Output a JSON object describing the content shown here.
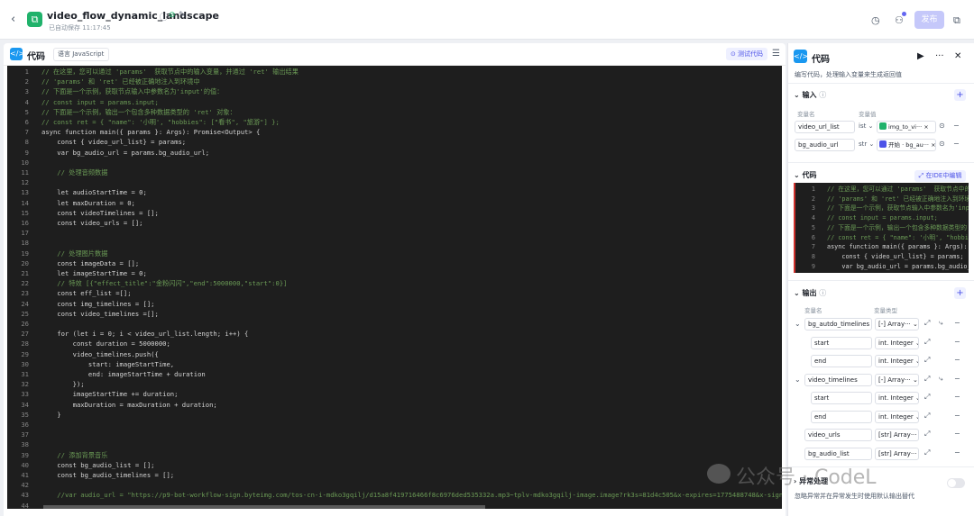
{
  "header": {
    "title": "video_flow_dynamic_landscape",
    "autosave": "已自动保存 11:17:45",
    "publish_label": "发布"
  },
  "code_panel": {
    "title": "代码",
    "language": "语言 JavaScript",
    "test_label": "测试代码",
    "lines": [
      {
        "n": "1",
        "t": "// 在这里，您可以通过 'params'  获取节点中的输入变量，并通过 'ret' 输出结果",
        "k": "comment"
      },
      {
        "n": "2",
        "t": "// 'params' 和 'ret' 已经被正确地注入到环境中",
        "k": "comment"
      },
      {
        "n": "3",
        "t": "// 下面是一个示例，获取节点输入中参数名为'input'的值：",
        "k": "comment"
      },
      {
        "n": "4",
        "t": "// const input = params.input;",
        "k": "comment"
      },
      {
        "n": "5",
        "t": "// 下面是一个示例，输出一个包含多种数据类型的 'ret' 对象：",
        "k": "comment"
      },
      {
        "n": "6",
        "t": "// const ret = { \"name\": '小明', \"hobbies\": [\"看书\", \"旅游\"] };",
        "k": "comment"
      },
      {
        "n": "7",
        "t": "async function main({ params }: Args): Promise<Output> {",
        "k": "kw"
      },
      {
        "n": "8",
        "t": "    const { video_url_list} = params;",
        "k": "kw"
      },
      {
        "n": "9",
        "t": "    var bg_audio_url = params.bg_audio_url;",
        "k": "kw"
      },
      {
        "n": "10",
        "t": "",
        "k": "kw"
      },
      {
        "n": "11",
        "t": "    // 处理音频数据",
        "k": "comment"
      },
      {
        "n": "12",
        "t": "",
        "k": "kw"
      },
      {
        "n": "13",
        "t": "    let audioStartTime = 0;",
        "k": "kw"
      },
      {
        "n": "14",
        "t": "    let maxDuration = 0;",
        "k": "kw"
      },
      {
        "n": "15",
        "t": "    const videoTimelines = [];",
        "k": "kw"
      },
      {
        "n": "16",
        "t": "    const video_urls = [];",
        "k": "kw"
      },
      {
        "n": "17",
        "t": "",
        "k": "kw"
      },
      {
        "n": "18",
        "t": "",
        "k": "kw"
      },
      {
        "n": "19",
        "t": "    // 处理图片数据",
        "k": "comment"
      },
      {
        "n": "20",
        "t": "    const imageData = [];",
        "k": "kw"
      },
      {
        "n": "21",
        "t": "    let imageStartTime = 0;",
        "k": "kw"
      },
      {
        "n": "22",
        "t": "    // 特效 [{\"effect_title\":\"金粉闪闪\",\"end\":5000000,\"start\":0}]",
        "k": "comment"
      },
      {
        "n": "23",
        "t": "    const eff_list =[];",
        "k": "kw"
      },
      {
        "n": "24",
        "t": "    const img_timelines = [];",
        "k": "kw"
      },
      {
        "n": "25",
        "t": "    const video_timelines =[];",
        "k": "kw"
      },
      {
        "n": "26",
        "t": "",
        "k": "kw"
      },
      {
        "n": "27",
        "t": "    for (let i = 0; i < video_url_list.length; i++) {",
        "k": "kw"
      },
      {
        "n": "28",
        "t": "        const duration = 5000000;",
        "k": "kw"
      },
      {
        "n": "29",
        "t": "        video_timelines.push({",
        "k": "kw"
      },
      {
        "n": "30",
        "t": "            start: imageStartTime,",
        "k": "squiggle"
      },
      {
        "n": "31",
        "t": "            end: imageStartTime + duration",
        "k": "squiggle"
      },
      {
        "n": "32",
        "t": "        });",
        "k": "kw"
      },
      {
        "n": "33",
        "t": "        imageStartTime += duration;",
        "k": "kw"
      },
      {
        "n": "34",
        "t": "        maxDuration = maxDuration + duration;",
        "k": "kw"
      },
      {
        "n": "35",
        "t": "    }",
        "k": "kw"
      },
      {
        "n": "36",
        "t": "",
        "k": "kw"
      },
      {
        "n": "37",
        "t": "",
        "k": "kw"
      },
      {
        "n": "38",
        "t": "",
        "k": "kw"
      },
      {
        "n": "39",
        "t": "    // 添加背景音乐",
        "k": "comment"
      },
      {
        "n": "40",
        "t": "    const bg_audio_list = [];",
        "k": "kw"
      },
      {
        "n": "41",
        "t": "    const bg_audio_timelines = [];",
        "k": "kw"
      },
      {
        "n": "42",
        "t": "",
        "k": "kw"
      },
      {
        "n": "43",
        "t": "    //var audio_url = \"https://p9-bot-workflow-sign.byteimg.com/tos-cn-i-mdko3gqilj/d15a8f419716466f8c6976ded535332a.mp3~tplv-mdko3gqilj-image.image?rk3s=81d4c505&x-expires=1775488748&x-signat",
        "k": "comment"
      },
      {
        "n": "44",
        "t": "",
        "k": "kw"
      }
    ]
  },
  "right_panel": {
    "title": "代码",
    "description": "编写代码，处理输入变量来生成返回值",
    "input_section": "输入",
    "col_var_name": "变量名",
    "col_var_value": "变量值",
    "inputs": [
      {
        "name": "video_url_list",
        "type": "ist",
        "ref": "img_to_vi···"
      },
      {
        "name": "bg_audio_url",
        "type": "str",
        "ref": "开始 · bg_au···"
      }
    ],
    "code_section": "代码",
    "ide_label": "在IDE中编辑",
    "output_section": "输出",
    "col_out_name": "变量名",
    "col_out_type": "变量类型",
    "outputs": [
      {
        "name": "bg_autdo_timelines",
        "type": "Array···",
        "icon": "[-]"
      },
      {
        "name": "start",
        "type": "Integer",
        "icon": "int."
      },
      {
        "name": "end",
        "type": "Integer",
        "icon": "int."
      },
      {
        "name": "video_timelines",
        "type": "Array···",
        "icon": "[-]"
      },
      {
        "name": "start",
        "type": "Integer",
        "icon": "int."
      },
      {
        "name": "end",
        "type": "Integer",
        "icon": "int."
      },
      {
        "name": "video_urls",
        "type": "Array···",
        "icon": "[str]"
      },
      {
        "name": "bg_audio_list",
        "type": "Array···",
        "icon": "[str]"
      }
    ],
    "exception_section": "异常处理",
    "exception_desc": "忽略异常并在异常发生时使用默认输出替代"
  },
  "watermark": "公众号 · CodeL"
}
